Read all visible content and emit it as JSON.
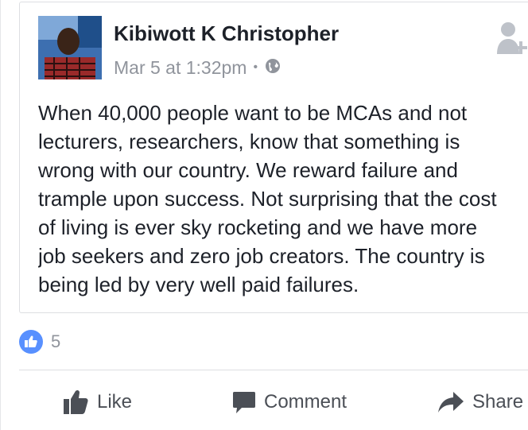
{
  "post": {
    "author": "Kibiwott K Christopher",
    "timestamp": "Mar 5 at 1:32pm",
    "separator": "•",
    "privacy_icon": "globe-icon",
    "text": "When 40,000 people want to be MCAs and not\nlecturers, researchers, know that something is\nwrong with our country. We reward failure and\ntrample upon success. Not surprising that the cost\nof living is ever sky rocketing and we have more\njob seekers and zero job creators. The country is\nbeing led by very well paid failures."
  },
  "reactions": {
    "icon": "thumbs-up-icon",
    "count": "5"
  },
  "actions": {
    "like": "Like",
    "comment": "Comment",
    "share": "Share"
  },
  "colors": {
    "like_blue": "#5890ff",
    "action_gray": "#4b4f56",
    "meta_gray": "#90949c"
  }
}
